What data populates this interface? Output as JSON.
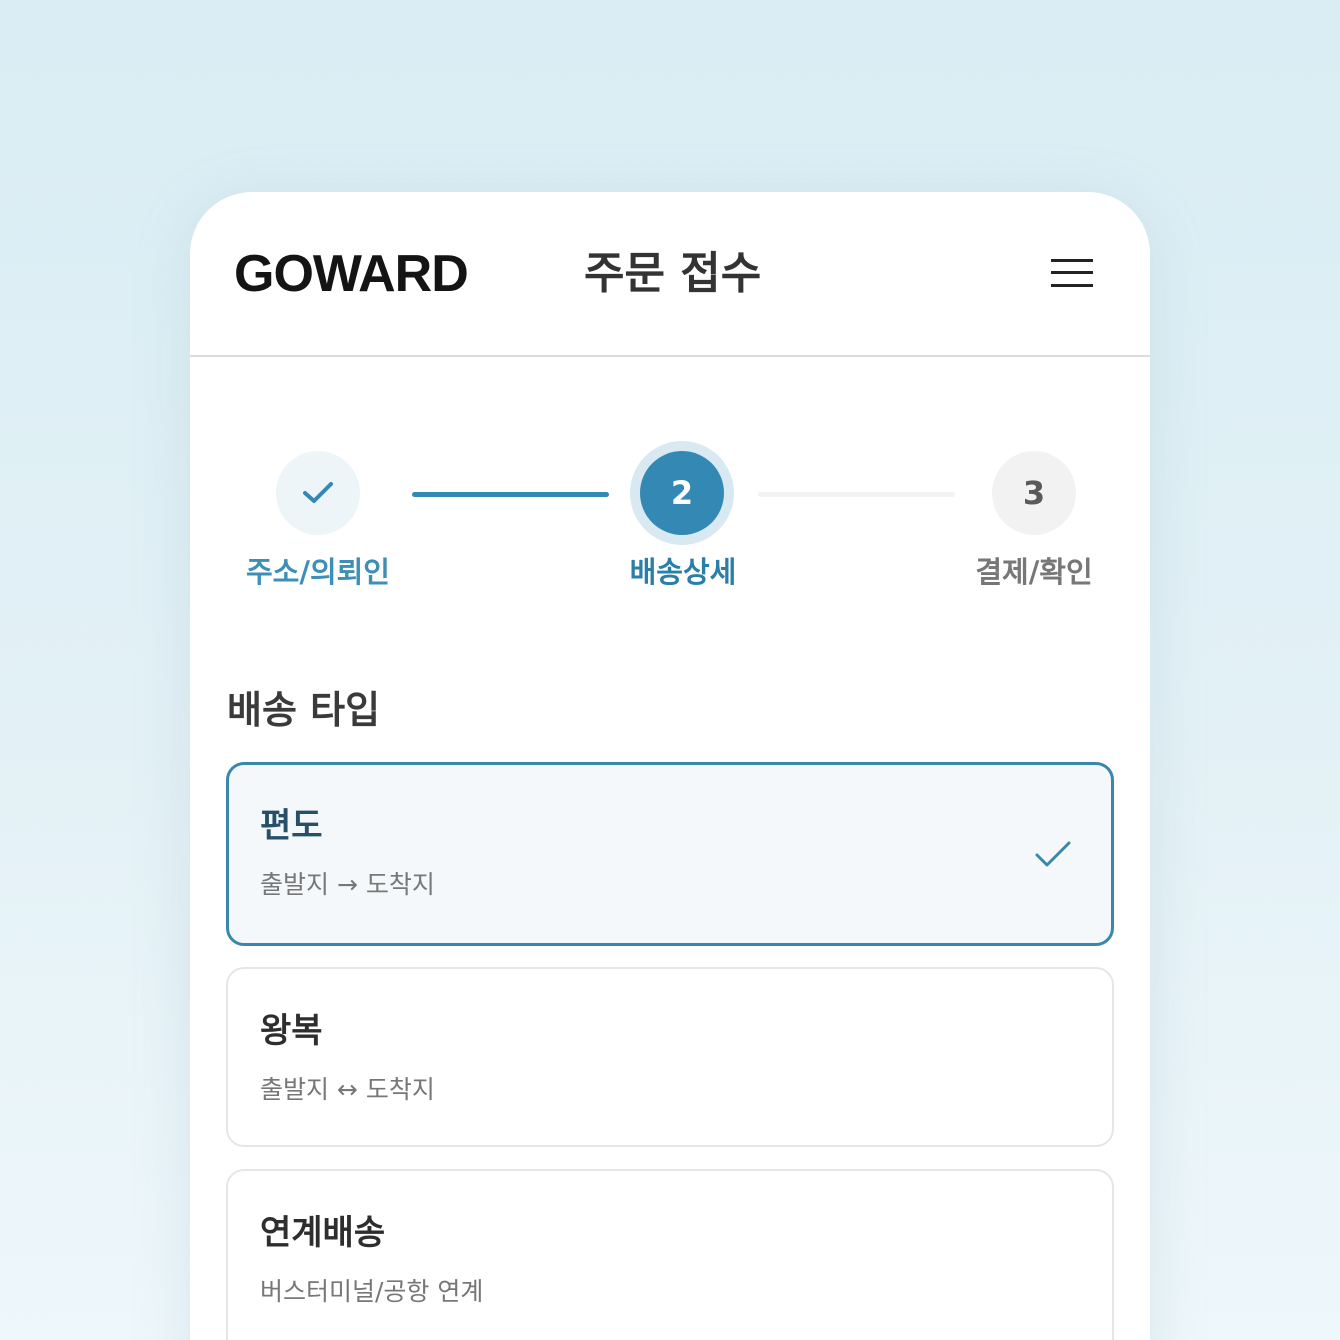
{
  "header": {
    "logo": "GOWARD",
    "title": "주문 접수",
    "menu_icon": "hamburger-menu-icon"
  },
  "stepper": {
    "current_step": 2,
    "steps": [
      {
        "number": "",
        "label": "주소/의뢰인",
        "state": "completed",
        "icon": "check-icon"
      },
      {
        "number": "2",
        "label": "배송상세",
        "state": "active"
      },
      {
        "number": "3",
        "label": "결제/확인",
        "state": "upcoming"
      }
    ]
  },
  "delivery": {
    "section_title": "배송 타입",
    "options": [
      {
        "title": "편도",
        "subtitle": "출발지 → 도착지",
        "selected": true
      },
      {
        "title": "왕복",
        "subtitle": "출발지 ↔ 도착지",
        "selected": false
      },
      {
        "title": "연계배송",
        "subtitle": "버스터미널/공항 연계",
        "selected": false
      }
    ]
  },
  "colors": {
    "accent": "#3389b4",
    "selected_border": "#3a87ae",
    "selected_bg": "#f5f8fa",
    "page_bg": "#d9edf4"
  }
}
